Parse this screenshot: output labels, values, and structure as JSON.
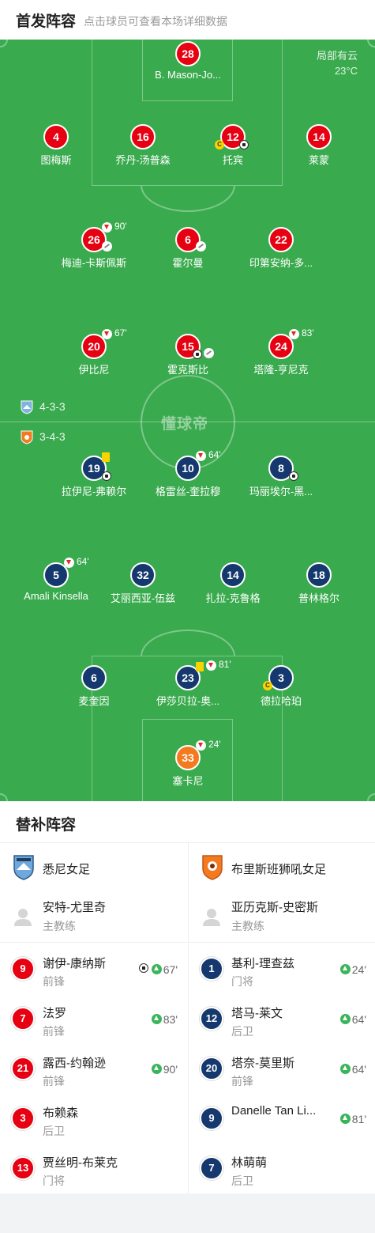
{
  "header": {
    "title": "首发阵容",
    "subtitle": "点击球员可查看本场详细数据"
  },
  "pitch": {
    "weather": "局部有云",
    "temperature": "23°C",
    "watermark": "懂球帝",
    "home_formation": "4-3-3",
    "away_formation": "3-4-3",
    "colors": {
      "grass": "#3aaa4e",
      "home": "#e60012",
      "away": "#15396e",
      "away_gk": "#f47a1f"
    }
  },
  "home_players": [
    {
      "num": "28",
      "name": "B. Mason-Jo..."
    },
    {
      "num": "4",
      "name": "图梅斯"
    },
    {
      "num": "16",
      "name": "乔丹-汤普森"
    },
    {
      "num": "12",
      "name": "托宾",
      "captain": "C"
    },
    {
      "num": "14",
      "name": "莱蒙"
    },
    {
      "num": "26",
      "name": "梅迪-卡斯佩斯",
      "sub_minute": "90'"
    },
    {
      "num": "6",
      "name": "霍尔曼"
    },
    {
      "num": "22",
      "name": "印第安纳-多..."
    },
    {
      "num": "20",
      "name": "伊比尼",
      "sub_minute": "67'"
    },
    {
      "num": "15",
      "name": "霍克斯比"
    },
    {
      "num": "24",
      "name": "塔隆-亨尼克",
      "sub_minute": "83'"
    }
  ],
  "away_players": [
    {
      "num": "19",
      "name": "拉伊尼-弗赖尔"
    },
    {
      "num": "10",
      "name": "格雷丝-奎拉穆",
      "sub_minute": "64'"
    },
    {
      "num": "8",
      "name": "玛丽埃尔-黑..."
    },
    {
      "num": "5",
      "name": "Amali Kinsella",
      "sub_minute": "64'"
    },
    {
      "num": "32",
      "name": "艾丽西亚-伍兹"
    },
    {
      "num": "14",
      "name": "扎拉-克鲁格"
    },
    {
      "num": "18",
      "name": "普林格尔"
    },
    {
      "num": "6",
      "name": "麦奎因"
    },
    {
      "num": "23",
      "name": "伊莎贝拉-奥...",
      "sub_minute": "81'"
    },
    {
      "num": "3",
      "name": "德拉哈珀",
      "captain": "C"
    },
    {
      "num": "33",
      "name": "塞卡尼",
      "sub_minute": "24'"
    }
  ],
  "subs": {
    "title": "替补阵容",
    "home": {
      "team": "悉尼女足",
      "coach_name": "安特-尤里奇",
      "coach_role": "主教练",
      "players": [
        {
          "num": "9",
          "name": "谢伊-康纳斯",
          "pos": "前锋",
          "minute": "67'"
        },
        {
          "num": "7",
          "name": "法罗",
          "pos": "前锋",
          "minute": "83'"
        },
        {
          "num": "21",
          "name": "露西-约翰逊",
          "pos": "前锋",
          "minute": "90'"
        },
        {
          "num": "3",
          "name": "布赖森",
          "pos": "后卫"
        },
        {
          "num": "13",
          "name": "贾丝明-布莱克",
          "pos": "门将"
        }
      ]
    },
    "away": {
      "team": "布里斯班狮吼女足",
      "coach_name": "亚历克斯-史密斯",
      "coach_role": "主教练",
      "players": [
        {
          "num": "1",
          "name": "基利-理查兹",
          "pos": "门将",
          "minute": "24'"
        },
        {
          "num": "12",
          "name": "塔马-莱文",
          "pos": "后卫",
          "minute": "64'"
        },
        {
          "num": "20",
          "name": "塔奈-莫里斯",
          "pos": "前锋",
          "minute": "64'"
        },
        {
          "num": "9",
          "name": "Danelle Tan Li...",
          "pos": "",
          "minute": "81'"
        },
        {
          "num": "7",
          "name": "林萌萌",
          "pos": "后卫"
        }
      ]
    }
  }
}
